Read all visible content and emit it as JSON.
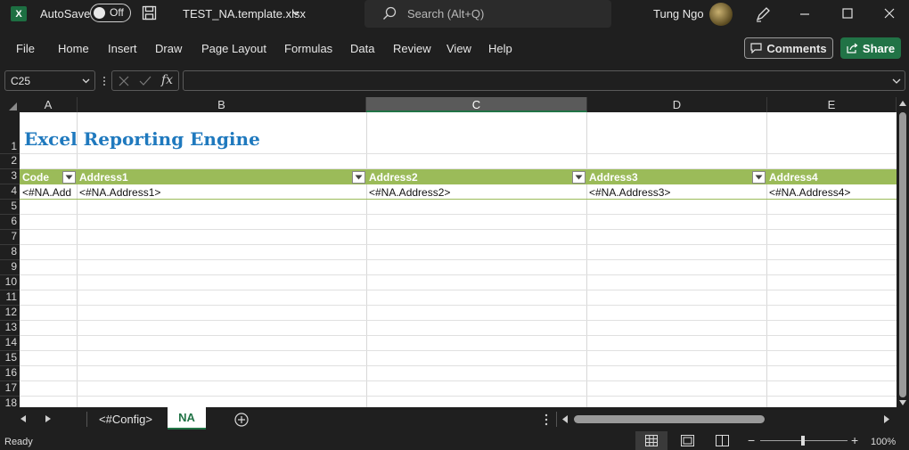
{
  "window": {
    "autosave_label": "AutoSave",
    "autosave_state": "Off",
    "filename": "TEST_NA.template.xlsx",
    "search_placeholder": "Search (Alt+Q)",
    "user_name": "Tung Ngo",
    "app_logo": "X"
  },
  "ribbon": {
    "tabs": [
      "File",
      "Home",
      "Insert",
      "Draw",
      "Page Layout",
      "Formulas",
      "Data",
      "Review",
      "View",
      "Help"
    ],
    "comments_label": "Comments",
    "share_label": "Share"
  },
  "formula": {
    "name_box": "C25",
    "content": "",
    "fx_label": "fx"
  },
  "columns": [
    "A",
    "B",
    "C",
    "D",
    "E"
  ],
  "rows": [
    "1",
    "2",
    "3",
    "4",
    "5",
    "6",
    "7",
    "8",
    "9",
    "10",
    "11",
    "12",
    "13",
    "14",
    "15",
    "16",
    "17",
    "18"
  ],
  "sheet": {
    "title": "Excel Reporting Engine",
    "headers": [
      "Code",
      "Address1",
      "Address2",
      "Address3",
      "Address4"
    ],
    "row4": [
      "<#NA.Add",
      "<#NA.Address1>",
      "<#NA.Address2>",
      "<#NA.Address3>",
      "<#NA.Address4>"
    ]
  },
  "tabs": {
    "sheet1": "<#Config>",
    "sheet2": "NA"
  },
  "status": {
    "ready": "Ready",
    "zoom": "100%"
  },
  "colors": {
    "accent": "#217346",
    "table_header": "#9bbb59",
    "title": "#1f79be"
  }
}
